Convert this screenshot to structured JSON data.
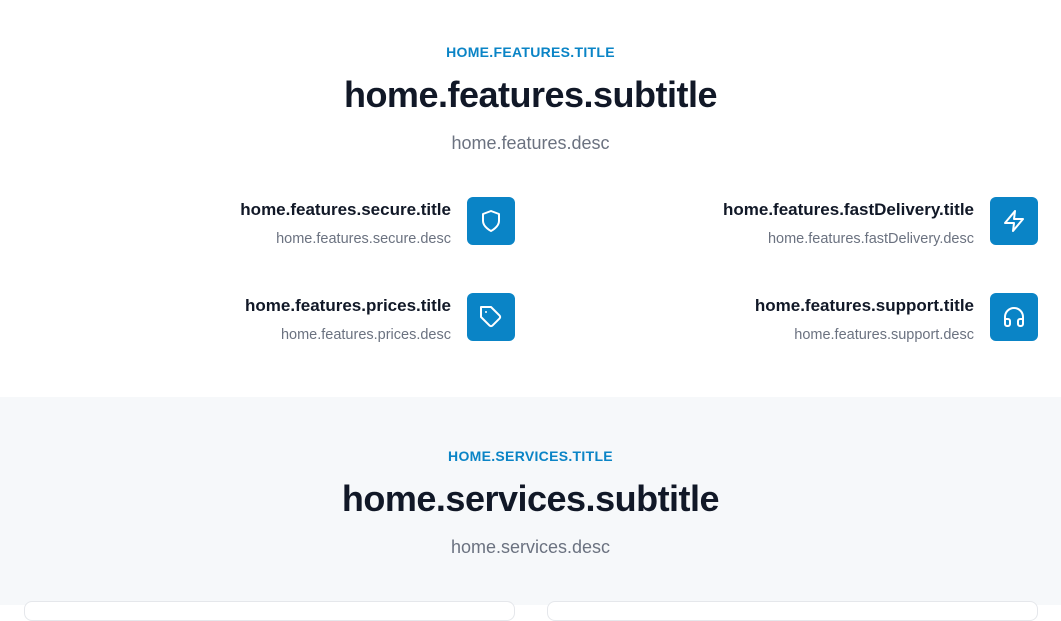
{
  "features": {
    "eyebrow": "HOME.FEATURES.TITLE",
    "title": "home.features.subtitle",
    "desc": "home.features.desc",
    "items": [
      {
        "title": "home.features.secure.title",
        "desc": "home.features.secure.desc",
        "icon": "shield-icon"
      },
      {
        "title": "home.features.fastDelivery.title",
        "desc": "home.features.fastDelivery.desc",
        "icon": "lightning-icon"
      },
      {
        "title": "home.features.prices.title",
        "desc": "home.features.prices.desc",
        "icon": "tag-icon"
      },
      {
        "title": "home.features.support.title",
        "desc": "home.features.support.desc",
        "icon": "headphones-icon"
      }
    ]
  },
  "services": {
    "eyebrow": "HOME.SERVICES.TITLE",
    "title": "home.services.subtitle",
    "desc": "home.services.desc"
  },
  "colors": {
    "accent": "#0a84c6",
    "heading": "#111827",
    "muted": "#6b7280",
    "section_alt_bg": "#f6f8fa"
  }
}
